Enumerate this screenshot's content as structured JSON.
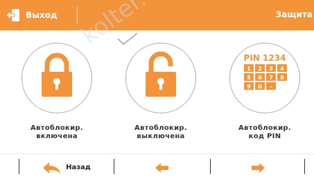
{
  "header": {
    "exit_label": "Выход",
    "title": "Защита"
  },
  "options": [
    {
      "label_line1": "Автоблокир.",
      "label_line2": "включена",
      "icon": "lock-closed-icon"
    },
    {
      "label_line1": "Автоблокир.",
      "label_line2": "выключена",
      "icon": "lock-open-icon",
      "selected": true
    },
    {
      "label_line1": "Автоблокир.",
      "label_line2": "код PIN",
      "icon": "pin-keypad-icon"
    }
  ],
  "pin_icon": {
    "title": "PIN 1234",
    "keys": [
      "1",
      "2",
      "3",
      "4",
      "5",
      "6",
      "7",
      "8",
      "9",
      "0"
    ]
  },
  "footer": {
    "back_label": "Назад"
  },
  "watermark": "kolter.com.ua",
  "colors": {
    "accent": "#f3943a",
    "text": "#333333"
  }
}
